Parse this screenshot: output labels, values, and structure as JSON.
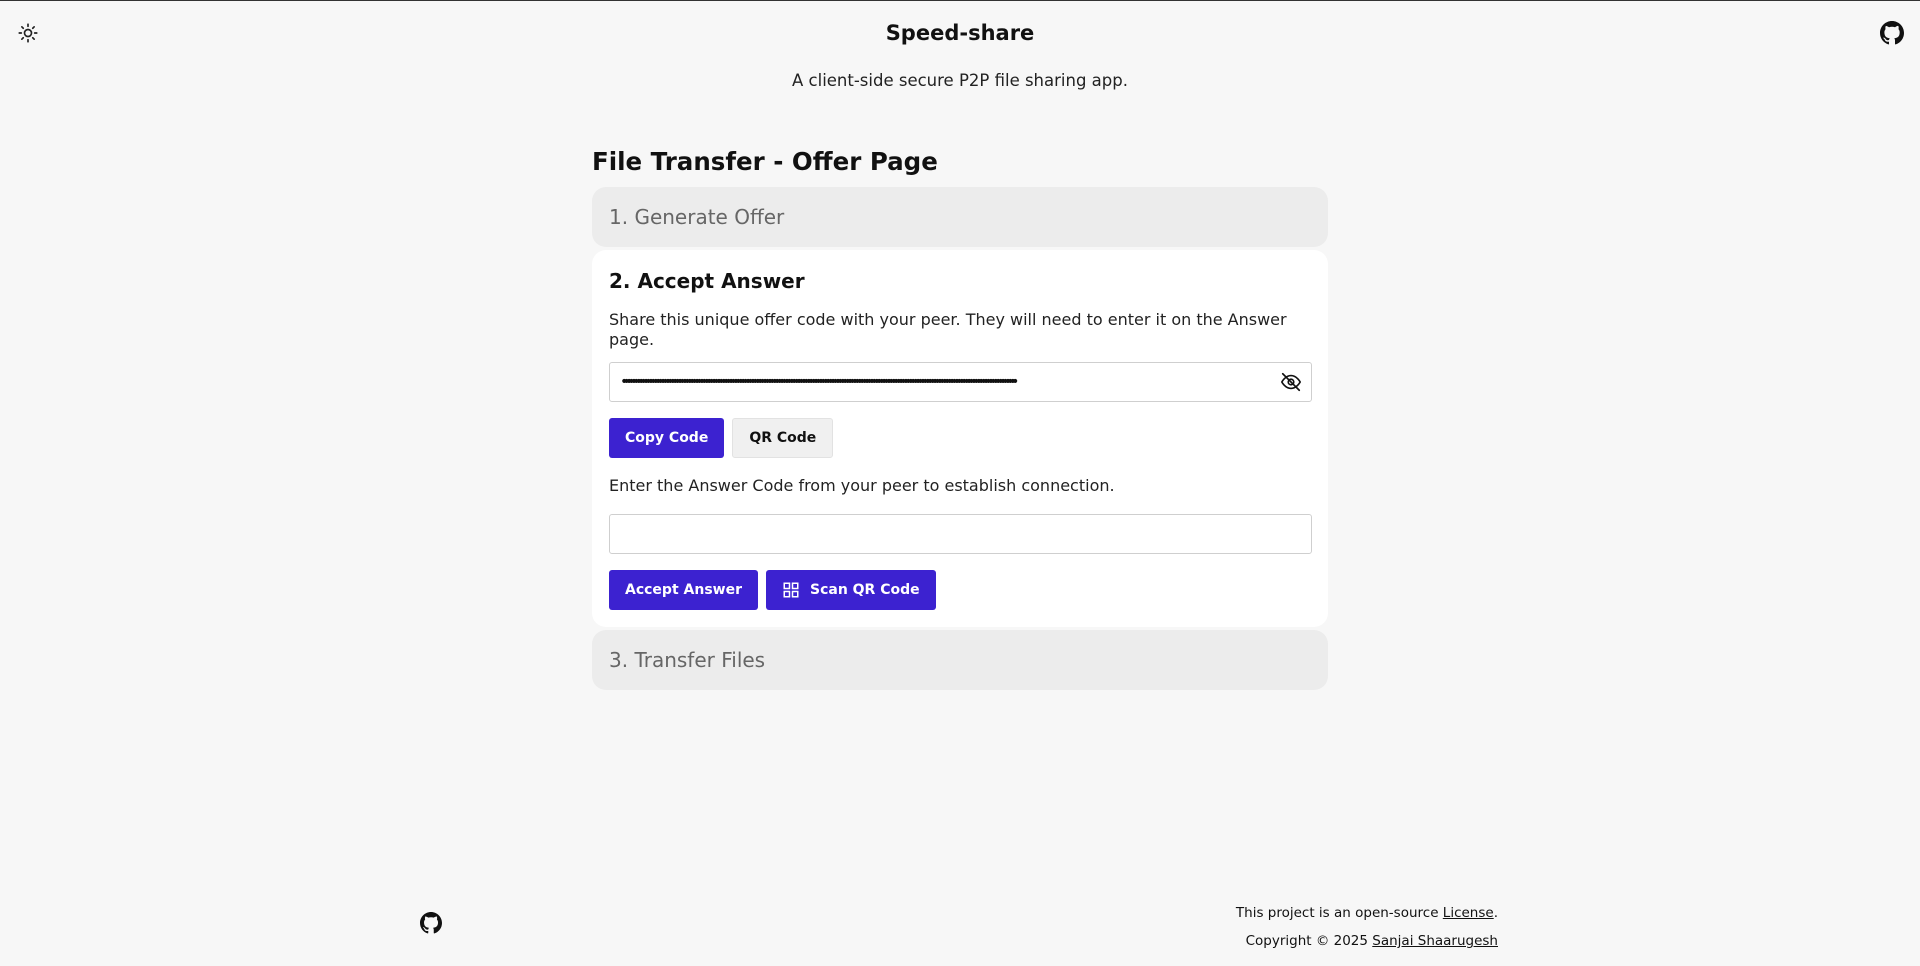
{
  "header": {
    "title": "Speed-share",
    "subtitle": "A client-side secure P2P file sharing app.",
    "theme_toggle_icon": "sun-icon",
    "github_icon": "github-icon"
  },
  "main": {
    "page_title": "File Transfer - Offer Page",
    "step1": {
      "label": "1. Generate Offer"
    },
    "step2": {
      "heading": "2. Accept Answer",
      "share_desc": "Share this unique offer code with your peer. They will need to enter it on the Answer page.",
      "offer_code_masked": "••••••••••••••••••••••••••••••••••••••••••••••••••••••••••••••••••••••••••••••••••••••••••••••••••••••••••••••••••••••••••••••••••••••••••••••••••••••••••••••••••",
      "copy_button": "Copy Code",
      "qr_button": "QR Code",
      "answer_desc": "Enter the Answer Code from your peer to establish connection.",
      "answer_value": "",
      "accept_button": "Accept Answer",
      "scan_button": "Scan QR Code"
    },
    "step3": {
      "label": "3. Transfer Files"
    }
  },
  "footer": {
    "license_prefix": "This project is an open-source ",
    "license_link": "License",
    "license_suffix": ".",
    "copyright_prefix": "Copyright © 2025 ",
    "author_link": "Sanjai Shaarugesh"
  },
  "colors": {
    "primary": "#3c22d0",
    "background": "#f7f7f7",
    "card": "#ffffff",
    "collapsed_step": "#ececec"
  }
}
